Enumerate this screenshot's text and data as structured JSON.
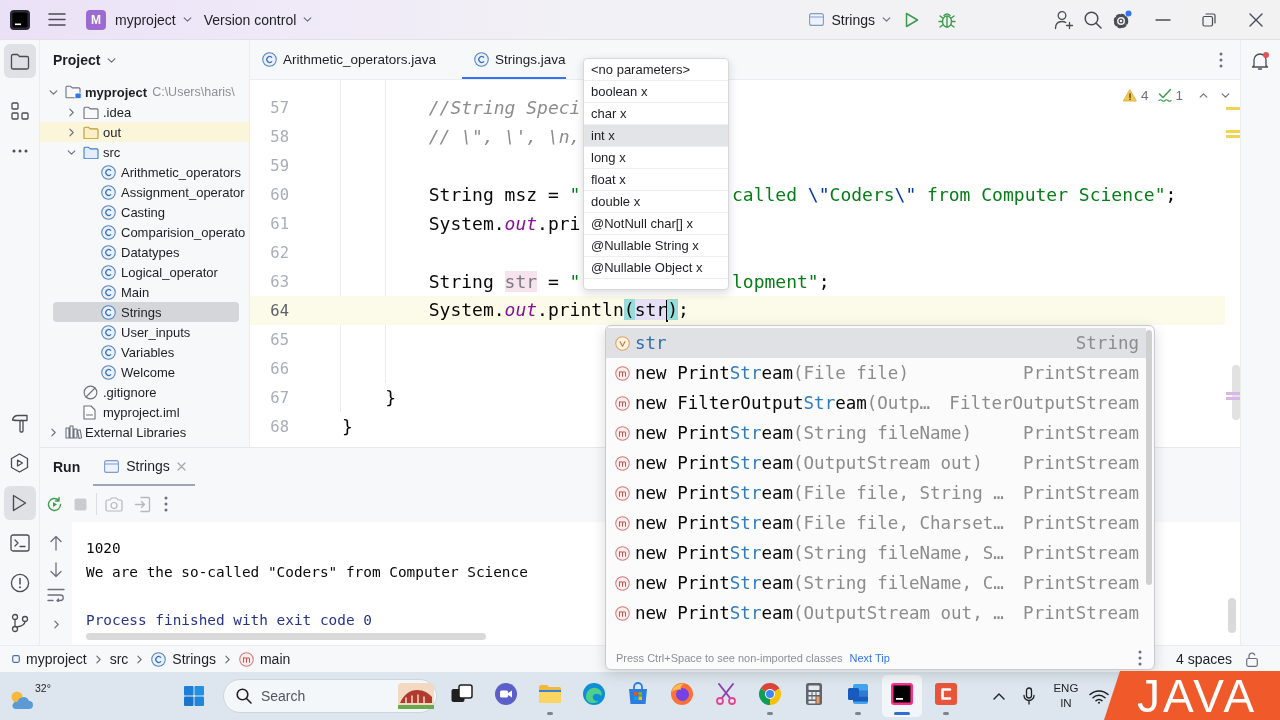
{
  "title_bar": {
    "project_badge": "M",
    "project": "myproject",
    "vcs_menu": "Version control",
    "run_configuration": "Strings"
  },
  "left_toolbar": {
    "top": [
      {
        "selected": true
      },
      {
        "selected": false
      },
      {
        "selected": false
      }
    ],
    "bottom": [
      {
        "selected": false
      },
      {
        "selected": false
      },
      {
        "selected": true
      },
      {
        "selected": false
      },
      {
        "selected": false
      },
      {
        "selected": false
      }
    ]
  },
  "project_panel": {
    "title": "Project",
    "tree": [
      {
        "label": "myproject",
        "path": "C:\\Users\\haris\\",
        "kind": "module",
        "expanded": true,
        "selected": false,
        "children": [
          {
            "label": ".idea",
            "kind": "folder",
            "expanded": false,
            "selected": false
          },
          {
            "label": "out",
            "kind": "excluded_folder",
            "expanded": false,
            "selected": false
          },
          {
            "label": "src",
            "kind": "source_folder",
            "expanded": true,
            "selected": false,
            "children": [
              {
                "label": "Arithmetic_operators",
                "kind": "class",
                "selected": false
              },
              {
                "label": "Assignment_operator",
                "kind": "class",
                "selected": false
              },
              {
                "label": "Casting",
                "kind": "class",
                "selected": false
              },
              {
                "label": "Comparision_operato",
                "kind": "class",
                "selected": false
              },
              {
                "label": "Datatypes",
                "kind": "class",
                "selected": false
              },
              {
                "label": "Logical_operator",
                "kind": "class",
                "selected": false
              },
              {
                "label": "Main",
                "kind": "class",
                "selected": false
              },
              {
                "label": "Strings",
                "kind": "class",
                "selected": true
              },
              {
                "label": "User_inputs",
                "kind": "class",
                "selected": false
              },
              {
                "label": "Variables",
                "kind": "class",
                "selected": false
              },
              {
                "label": "Welcome",
                "kind": "class",
                "selected": false
              }
            ]
          },
          {
            "label": ".gitignore",
            "kind": "ignore_file",
            "selected": false
          },
          {
            "label": "myproject.iml",
            "kind": "module_file",
            "selected": false
          }
        ]
      },
      {
        "label": "External Libraries",
        "kind": "libraries",
        "expanded": false,
        "selected": false
      }
    ]
  },
  "editor": {
    "tabs": [
      {
        "label": "Arithmetic_operators.java",
        "selected": false
      },
      {
        "label": "Strings.java",
        "selected": true
      }
    ],
    "inspections": {
      "warnings": "4",
      "weak_warnings": "1"
    },
    "lines": [
      {
        "number": "57",
        "tokens": [
          {
            "text": "        //String Speci",
            "kind": "comment"
          }
        ]
      },
      {
        "number": "58",
        "tokens": [
          {
            "text": "        // \\\", \\', \\n,",
            "kind": "comment"
          }
        ]
      },
      {
        "number": "59"
      },
      {
        "number": "60",
        "tokens": [
          {
            "text": "        String msz = ",
            "kind": "plain"
          },
          {
            "text": "\"",
            "kind": "string"
          }
        ],
        "tail": [
          {
            "text": "called ",
            "kind": "string"
          },
          {
            "text": "\\\"",
            "kind": "escape"
          },
          {
            "text": "Coders",
            "kind": "string"
          },
          {
            "text": "\\\"",
            "kind": "escape"
          },
          {
            "text": " from Computer Science\"",
            "kind": "string"
          },
          {
            "text": ";",
            "kind": "plain"
          }
        ]
      },
      {
        "number": "61",
        "tokens": [
          {
            "text": "        System.",
            "kind": "plain"
          },
          {
            "text": "out",
            "kind": "static_field"
          },
          {
            "text": ".pri",
            "kind": "plain"
          }
        ]
      },
      {
        "number": "62"
      },
      {
        "number": "63",
        "tokens": [
          {
            "text": "        String ",
            "kind": "plain"
          },
          {
            "text": "str",
            "kind": "declaration_usage"
          },
          {
            "text": " = ",
            "kind": "plain"
          },
          {
            "text": "\"",
            "kind": "string"
          }
        ],
        "tail": [
          {
            "text": "lopment\"",
            "kind": "string"
          },
          {
            "text": ";",
            "kind": "plain"
          }
        ]
      },
      {
        "number": "64",
        "tokens": [
          {
            "text": "        System.",
            "kind": "plain"
          },
          {
            "text": "out",
            "kind": "static_field"
          },
          {
            "text": ".println",
            "kind": "plain"
          },
          {
            "text": "(",
            "kind": "brace_match"
          },
          {
            "text": "str",
            "kind": "read_usage"
          },
          {
            "kind": "caret"
          },
          {
            "text": ")",
            "kind": "brace_match"
          },
          {
            "text": ";",
            "kind": "plain"
          }
        ]
      },
      {
        "number": "65"
      },
      {
        "number": "66"
      },
      {
        "number": "67",
        "tokens": [
          {
            "text": "    }",
            "kind": "plain"
          }
        ]
      },
      {
        "number": "68",
        "tokens": [
          {
            "text": "}",
            "kind": "plain"
          }
        ]
      }
    ]
  },
  "parameter_info": {
    "items": [
      {
        "label": "<no parameters>",
        "selected": false
      },
      {
        "label": "boolean x",
        "selected": false
      },
      {
        "label": "char x",
        "selected": false
      },
      {
        "label": "int x",
        "selected": true
      },
      {
        "label": "long x",
        "selected": false
      },
      {
        "label": "float x",
        "selected": false
      },
      {
        "label": "double x",
        "selected": false
      },
      {
        "label": "@NotNull char[] x",
        "selected": false
      },
      {
        "label": "@Nullable String x",
        "selected": false
      },
      {
        "label": "@Nullable Object x",
        "selected": false
      }
    ]
  },
  "completion": {
    "items": [
      {
        "kind": "variable",
        "name": "str",
        "type": "String",
        "selected": true
      },
      {
        "kind": "method",
        "name": "new Print**Str**eam",
        "params": "(File file)",
        "type": "PrintStream",
        "selected": false
      },
      {
        "kind": "method",
        "name": "new FilterOutput**Str**eam",
        "params": "(Outp…",
        "type": "FilterOutputStream",
        "selected": false
      },
      {
        "kind": "method",
        "name": "new Print**Str**eam",
        "params": "(String fileName)",
        "type": "PrintStream",
        "selected": false
      },
      {
        "kind": "method",
        "name": "new Print**Str**eam",
        "params": "(OutputStream out)",
        "type": "PrintStream",
        "selected": false
      },
      {
        "kind": "method",
        "name": "new Print**Str**eam",
        "params": "(File file, String …",
        "type": "PrintStream",
        "selected": false
      },
      {
        "kind": "method",
        "name": "new Print**Str**eam",
        "params": "(File file, Charset…",
        "type": "PrintStream",
        "selected": false
      },
      {
        "kind": "method",
        "name": "new Print**Str**eam",
        "params": "(String fileName, S…",
        "type": "PrintStream",
        "selected": false
      },
      {
        "kind": "method",
        "name": "new Print**Str**eam",
        "params": "(String fileName, C…",
        "type": "PrintStream",
        "selected": false
      },
      {
        "kind": "method",
        "name": "new Print**Str**eam",
        "params": "(OutputStream out, …",
        "type": "PrintStream",
        "selected": false
      }
    ],
    "hint": "Press Ctrl+Space to see non-imported classes",
    "link": "Next Tip"
  },
  "run_panel": {
    "title": "Run",
    "tabs": [
      {
        "label": "Strings",
        "selected": true
      }
    ],
    "toolbar": [
      {
        "disabled": false
      },
      {
        "disabled": true
      },
      {
        "disabled": true
      },
      {
        "disabled": true
      }
    ],
    "output": [
      {
        "text": "1020",
        "kind": "stdout"
      },
      {
        "text": "We are the so-called \"Coders\" from Computer Science",
        "kind": "stdout"
      },
      {
        "text": "Process finished with exit code 0",
        "kind": "exit"
      }
    ]
  },
  "status_bar": {
    "breadcrumbs": [
      {
        "label": "myproject",
        "kind": "module"
      },
      {
        "label": "src",
        "kind": "folder"
      },
      {
        "label": "Strings",
        "kind": "class"
      },
      {
        "label": "main",
        "kind": "method"
      }
    ],
    "indent": "4 spaces"
  },
  "taskbar": {
    "weather": "32°",
    "search": {
      "placeholder": "Search"
    },
    "apps": [
      {
        "running": false,
        "selected": false
      },
      {
        "running": false,
        "selected": false
      },
      {
        "running": true,
        "selected": false
      },
      {
        "running": false,
        "selected": false
      },
      {
        "running": false,
        "selected": false
      },
      {
        "running": false,
        "selected": false
      },
      {
        "running": false,
        "selected": false
      },
      {
        "running": true,
        "selected": false
      },
      {
        "running": false,
        "selected": false
      },
      {
        "running": true,
        "selected": false
      },
      {
        "running": true,
        "selected": true
      },
      {
        "running": true,
        "selected": false
      }
    ],
    "language": "ENG IN"
  },
  "overlay_banner": {
    "text": "JAVA"
  }
}
